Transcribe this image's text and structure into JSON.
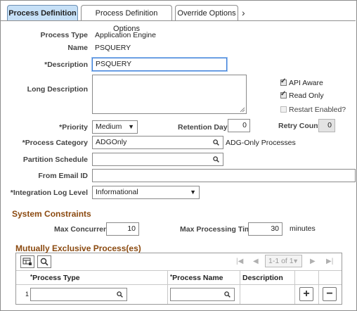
{
  "tabs": [
    {
      "label": "Process Definition"
    },
    {
      "label": "Process Definition Options"
    },
    {
      "label": "Override Options"
    }
  ],
  "header": {
    "process_type_label": "Process Type",
    "process_type_value": "Application Engine",
    "name_label": "Name",
    "name_value": "PSQUERY"
  },
  "form": {
    "description_label": "*Description",
    "description_value": "PSQUERY",
    "long_description_label": "Long Description",
    "api_aware_label": "API Aware",
    "read_only_label": "Read Only",
    "restart_enabled_label": "Restart Enabled?",
    "priority_label": "*Priority",
    "priority_value": "Medium",
    "retention_days_label": "Retention Days",
    "retention_days_value": "0",
    "retry_count_label": "Retry Count",
    "retry_count_value": "0",
    "process_category_label": "*Process Category",
    "process_category_value": "ADGOnly",
    "process_category_desc": "ADG-Only Processes",
    "partition_schedule_label": "Partition Schedule",
    "from_email_label": "From Email ID",
    "integration_log_label": "*Integration Log Level",
    "integration_log_value": "Informational"
  },
  "system_constraints": {
    "title": "System Constraints",
    "max_concurrent_label": "Max Concurrent",
    "max_concurrent_value": "10",
    "max_processing_label": "Max Processing Time",
    "max_processing_value": "30",
    "minutes_label": "minutes"
  },
  "mutex": {
    "title": "Mutually Exclusive Process(es)",
    "pager_text": "1-1 of 1",
    "columns": [
      "Process Type",
      "Process Name",
      "Description"
    ],
    "row_number": "1"
  }
}
